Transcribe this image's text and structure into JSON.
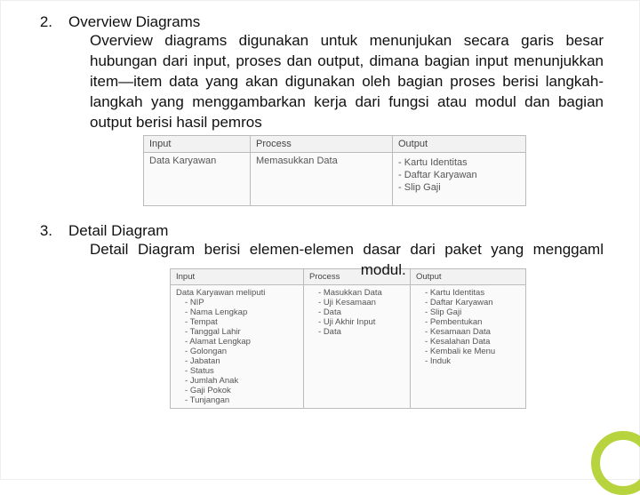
{
  "sections": [
    {
      "num": "2.",
      "title": "Overview Diagrams",
      "body": "Overview diagrams digunakan untuk menunjukan secara garis besar hubungan dari input, proses dan output, dimana bagian input menunjukkan item—item data yang akan digunakan oleh bagian proses berisi langkah-langkah yang menggambarkan kerja dari fungsi atau modul dan bagian output berisi hasil pemros"
    },
    {
      "num": "3.",
      "title": "Detail Diagram",
      "body_pre": "Detail Diagram berisi elemen-elemen dasar dari paket yang menggaml",
      "body_post": "modul."
    }
  ],
  "overview_table": {
    "headers": [
      "Input",
      "Process",
      "Output"
    ],
    "input": "Data Karyawan",
    "process": "Memasukkan Data",
    "outputs": [
      "Kartu Identitas",
      "Daftar Karyawan",
      "Slip Gaji"
    ]
  },
  "detail_table": {
    "headers": [
      "Input",
      "Process",
      "Output"
    ],
    "input_head": "Data Karyawan meliputi",
    "input_items": [
      "NIP",
      "Nama Lengkap",
      "Tempat",
      "Tanggal Lahir",
      "Alamat Lengkap",
      "Golongan",
      "Jabatan",
      "Status",
      "Jumlah Anak",
      "Gaji Pokok",
      "Tunjangan"
    ],
    "process_items": [
      "Masukkan Data",
      "Uji Kesamaan",
      "Data",
      "Uji Akhir Input",
      "Data"
    ],
    "output_items": [
      "Kartu Identitas",
      "Daftar Karyawan",
      "Slip Gaji",
      "Pembentukan",
      "Kesamaan Data",
      "Kesalahan Data",
      "Kembali ke Menu",
      "Induk"
    ]
  }
}
